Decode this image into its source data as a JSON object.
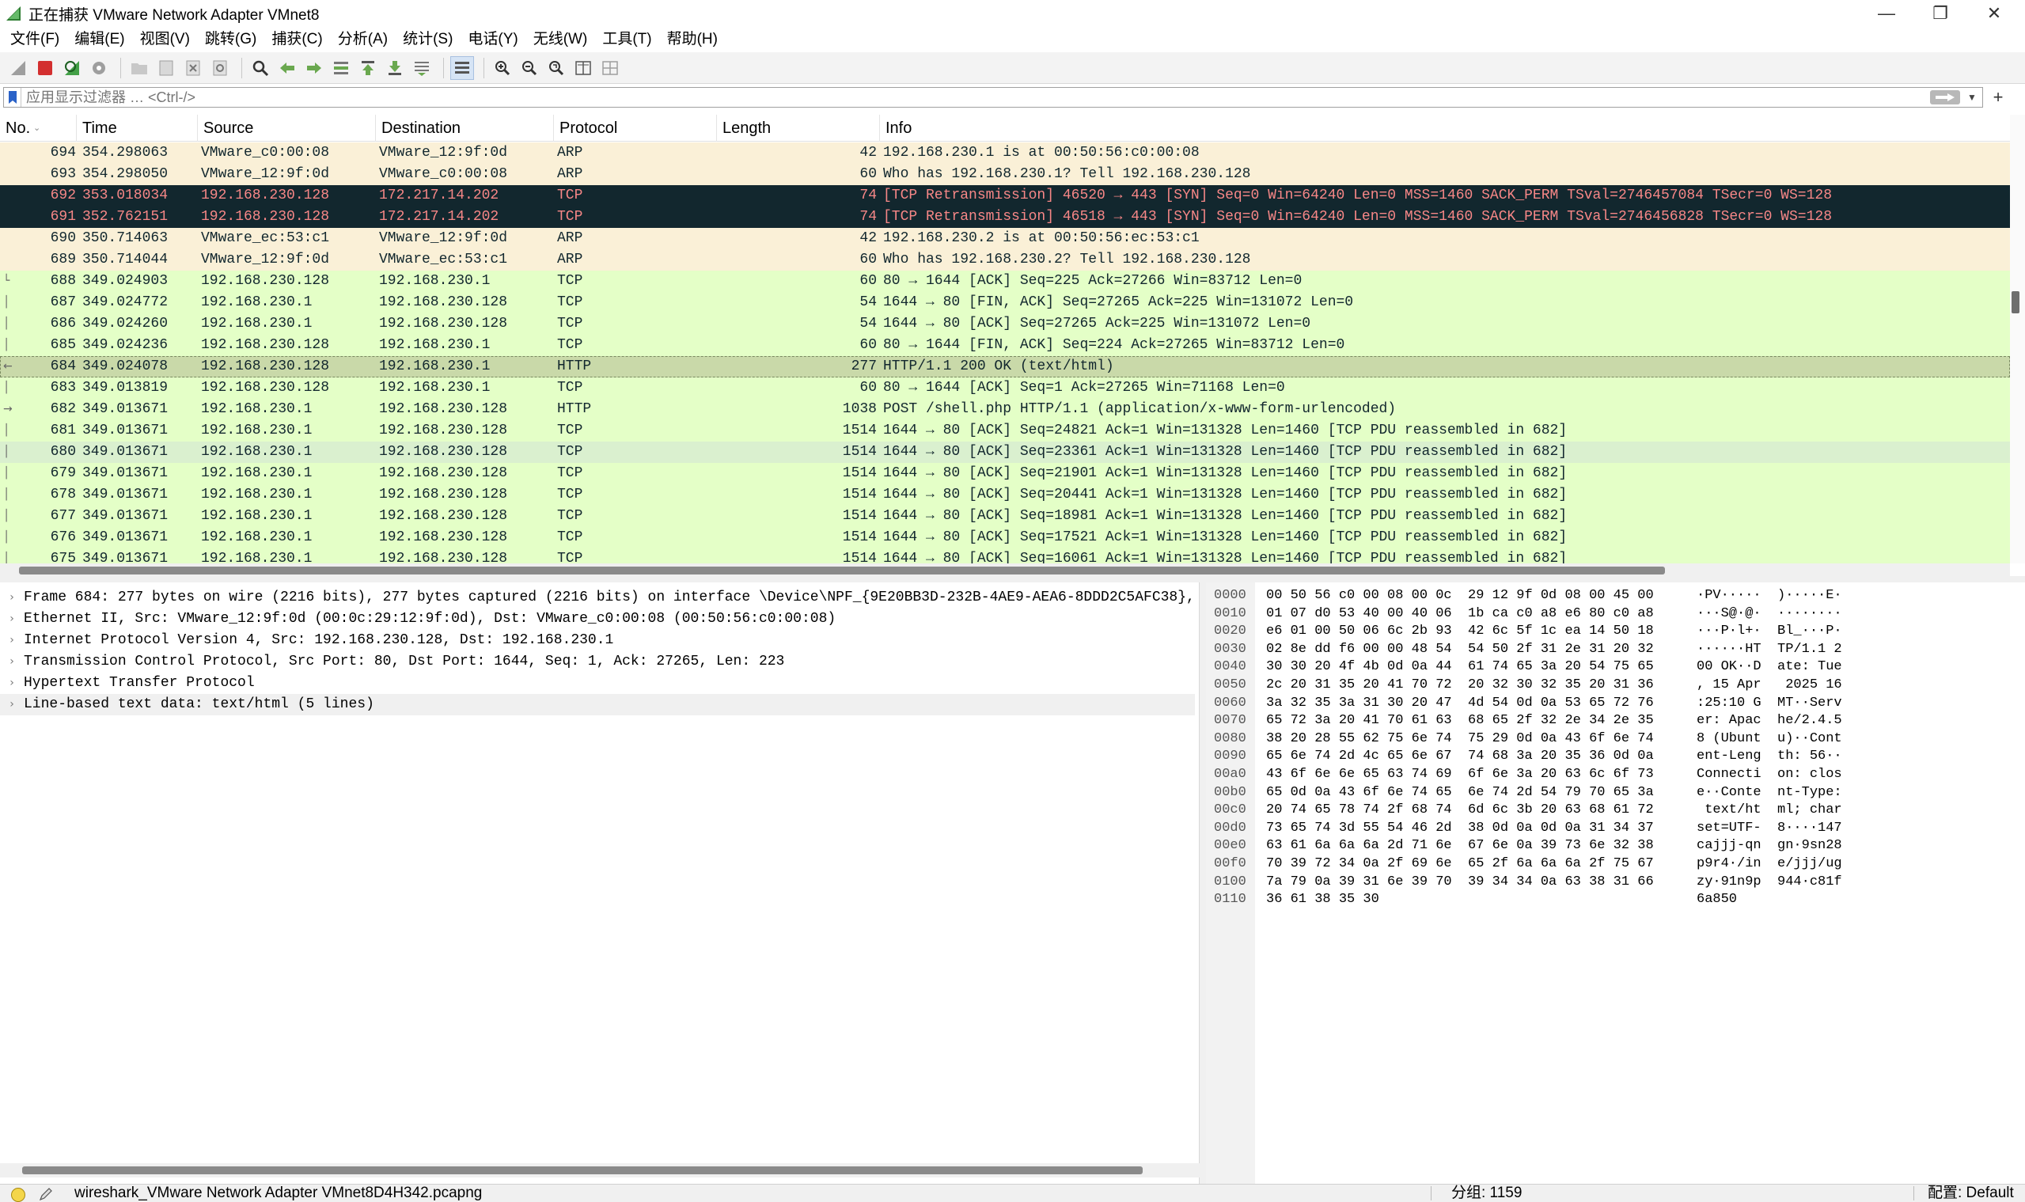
{
  "window": {
    "title": "正在捕获 VMware Network Adapter VMnet8",
    "minimize": "—",
    "maximize": "❐",
    "close": "✕"
  },
  "menu": [
    "文件(F)",
    "编辑(E)",
    "视图(V)",
    "跳转(G)",
    "捕获(C)",
    "分析(A)",
    "统计(S)",
    "电话(Y)",
    "无线(W)",
    "工具(T)",
    "帮助(H)"
  ],
  "filter": {
    "placeholder": "应用显示过滤器 … <Ctrl-/>",
    "plus": "+"
  },
  "packet_list": {
    "columns": [
      "No.",
      "Time",
      "Source",
      "Destination",
      "Protocol",
      "Length",
      "Info"
    ],
    "row_colors": {
      "arp": "#faf0d7",
      "tcp_bad": "#12272e",
      "tcp_bad_text": "#f78787",
      "tcp": "#e7e6ff",
      "http": "#e4ffc7",
      "http_selected": "#c9d9a9",
      "tcp_highlight": "#daf0cf",
      "text": "#12272e"
    },
    "rows": [
      {
        "no": "694",
        "time": "354.298063",
        "src": "VMware_c0:00:08",
        "dst": "VMware_12:9f:0d",
        "proto": "ARP",
        "len": "42",
        "info": "192.168.230.1 is at 00:50:56:c0:00:08",
        "color": "arp",
        "rel": ""
      },
      {
        "no": "693",
        "time": "354.298050",
        "src": "VMware_12:9f:0d",
        "dst": "VMware_c0:00:08",
        "proto": "ARP",
        "len": "60",
        "info": "Who has 192.168.230.1? Tell 192.168.230.128",
        "color": "arp",
        "rel": ""
      },
      {
        "no": "692",
        "time": "353.018034",
        "src": "192.168.230.128",
        "dst": "172.217.14.202",
        "proto": "TCP",
        "len": "74",
        "info": "[TCP Retransmission] 46520 → 443 [SYN] Seq=0 Win=64240 Len=0 MSS=1460 SACK_PERM TSval=2746457084 TSecr=0 WS=128",
        "color": "tcp_bad",
        "rel": ""
      },
      {
        "no": "691",
        "time": "352.762151",
        "src": "192.168.230.128",
        "dst": "172.217.14.202",
        "proto": "TCP",
        "len": "74",
        "info": "[TCP Retransmission] 46518 → 443 [SYN] Seq=0 Win=64240 Len=0 MSS=1460 SACK_PERM TSval=2746456828 TSecr=0 WS=128",
        "color": "tcp_bad",
        "rel": ""
      },
      {
        "no": "690",
        "time": "350.714063",
        "src": "VMware_ec:53:c1",
        "dst": "VMware_12:9f:0d",
        "proto": "ARP",
        "len": "42",
        "info": "192.168.230.2 is at 00:50:56:ec:53:c1",
        "color": "arp",
        "rel": ""
      },
      {
        "no": "689",
        "time": "350.714044",
        "src": "VMware_12:9f:0d",
        "dst": "VMware_ec:53:c1",
        "proto": "ARP",
        "len": "60",
        "info": "Who has 192.168.230.2? Tell 192.168.230.128",
        "color": "arp",
        "rel": ""
      },
      {
        "no": "688",
        "time": "349.024903",
        "src": "192.168.230.128",
        "dst": "192.168.230.1",
        "proto": "TCP",
        "len": "60",
        "info": "80 → 1644 [ACK] Seq=225 Ack=27266 Win=83712 Len=0",
        "color": "http",
        "rel": "└"
      },
      {
        "no": "687",
        "time": "349.024772",
        "src": "192.168.230.1",
        "dst": "192.168.230.128",
        "proto": "TCP",
        "len": "54",
        "info": "1644 → 80 [FIN, ACK] Seq=27265 Ack=225 Win=131072 Len=0",
        "color": "http",
        "rel": "│"
      },
      {
        "no": "686",
        "time": "349.024260",
        "src": "192.168.230.1",
        "dst": "192.168.230.128",
        "proto": "TCP",
        "len": "54",
        "info": "1644 → 80 [ACK] Seq=27265 Ack=225 Win=131072 Len=0",
        "color": "http",
        "rel": "│"
      },
      {
        "no": "685",
        "time": "349.024236",
        "src": "192.168.230.128",
        "dst": "192.168.230.1",
        "proto": "TCP",
        "len": "60",
        "info": "80 → 1644 [FIN, ACK] Seq=224 Ack=27265 Win=83712 Len=0",
        "color": "http",
        "rel": "│"
      },
      {
        "no": "684",
        "time": "349.024078",
        "src": "192.168.230.128",
        "dst": "192.168.230.1",
        "proto": "HTTP",
        "len": "277",
        "info": "HTTP/1.1 200 OK  (text/html)",
        "color": "http_selected",
        "rel": "←"
      },
      {
        "no": "683",
        "time": "349.013819",
        "src": "192.168.230.128",
        "dst": "192.168.230.1",
        "proto": "TCP",
        "len": "60",
        "info": "80 → 1644 [ACK] Seq=1 Ack=27265 Win=71168 Len=0",
        "color": "http",
        "rel": "│"
      },
      {
        "no": "682",
        "time": "349.013671",
        "src": "192.168.230.1",
        "dst": "192.168.230.128",
        "proto": "HTTP",
        "len": "1038",
        "info": "POST /shell.php HTTP/1.1  (application/x-www-form-urlencoded)",
        "color": "http",
        "rel": "→"
      },
      {
        "no": "681",
        "time": "349.013671",
        "src": "192.168.230.1",
        "dst": "192.168.230.128",
        "proto": "TCP",
        "len": "1514",
        "info": "1644 → 80 [ACK] Seq=24821 Ack=1 Win=131328 Len=1460 [TCP PDU reassembled in 682]",
        "color": "http",
        "rel": "│"
      },
      {
        "no": "680",
        "time": "349.013671",
        "src": "192.168.230.1",
        "dst": "192.168.230.128",
        "proto": "TCP",
        "len": "1514",
        "info": "1644 → 80 [ACK] Seq=23361 Ack=1 Win=131328 Len=1460 [TCP PDU reassembled in 682]",
        "color": "tcp_highlight",
        "rel": "│"
      },
      {
        "no": "679",
        "time": "349.013671",
        "src": "192.168.230.1",
        "dst": "192.168.230.128",
        "proto": "TCP",
        "len": "1514",
        "info": "1644 → 80 [ACK] Seq=21901 Ack=1 Win=131328 Len=1460 [TCP PDU reassembled in 682]",
        "color": "http",
        "rel": "│"
      },
      {
        "no": "678",
        "time": "349.013671",
        "src": "192.168.230.1",
        "dst": "192.168.230.128",
        "proto": "TCP",
        "len": "1514",
        "info": "1644 → 80 [ACK] Seq=20441 Ack=1 Win=131328 Len=1460 [TCP PDU reassembled in 682]",
        "color": "http",
        "rel": "│"
      },
      {
        "no": "677",
        "time": "349.013671",
        "src": "192.168.230.1",
        "dst": "192.168.230.128",
        "proto": "TCP",
        "len": "1514",
        "info": "1644 → 80 [ACK] Seq=18981 Ack=1 Win=131328 Len=1460 [TCP PDU reassembled in 682]",
        "color": "http",
        "rel": "│"
      },
      {
        "no": "676",
        "time": "349.013671",
        "src": "192.168.230.1",
        "dst": "192.168.230.128",
        "proto": "TCP",
        "len": "1514",
        "info": "1644 → 80 [ACK] Seq=17521 Ack=1 Win=131328 Len=1460 [TCP PDU reassembled in 682]",
        "color": "http",
        "rel": "│"
      },
      {
        "no": "675",
        "time": "349.013671",
        "src": "192.168.230.1",
        "dst": "192.168.230.128",
        "proto": "TCP",
        "len": "1514",
        "info": "1644 → 80 [ACK] Seq=16061 Ack=1 Win=131328 Len=1460 [TCP PDU reassembled in 682]",
        "color": "http",
        "rel": "│"
      }
    ]
  },
  "details": [
    "Frame 684: 277 bytes on wire (2216 bits), 277 bytes captured (2216 bits) on interface \\Device\\NPF_{9E20BB3D-232B-4AE9-AEA6-8DDD2C5AFC38},",
    "Ethernet II, Src: VMware_12:9f:0d (00:0c:29:12:9f:0d), Dst: VMware_c0:00:08 (00:50:56:c0:00:08)",
    "Internet Protocol Version 4, Src: 192.168.230.128, Dst: 192.168.230.1",
    "Transmission Control Protocol, Src Port: 80, Dst Port: 1644, Seq: 1, Ack: 27265, Len: 223",
    "Hypertext Transfer Protocol",
    "Line-based text data: text/html (5 lines)"
  ],
  "bytes": [
    {
      "off": "0000",
      "hex": "00 50 56 c0 00 08 00 0c  29 12 9f 0d 08 00 45 00",
      "ascii": "·PV·····  )·····E·"
    },
    {
      "off": "0010",
      "hex": "01 07 d0 53 40 00 40 06  1b ca c0 a8 e6 80 c0 a8",
      "ascii": "···S@·@·  ········"
    },
    {
      "off": "0020",
      "hex": "e6 01 00 50 06 6c 2b 93  42 6c 5f 1c ea 14 50 18",
      "ascii": "···P·l+·  Bl_···P·"
    },
    {
      "off": "0030",
      "hex": "02 8e dd f6 00 00 48 54  54 50 2f 31 2e 31 20 32",
      "ascii": "······HT  TP/1.1 2"
    },
    {
      "off": "0040",
      "hex": "30 30 20 4f 4b 0d 0a 44  61 74 65 3a 20 54 75 65",
      "ascii": "00 OK··D  ate: Tue"
    },
    {
      "off": "0050",
      "hex": "2c 20 31 35 20 41 70 72  20 32 30 32 35 20 31 36",
      "ascii": ", 15 Apr   2025 16"
    },
    {
      "off": "0060",
      "hex": "3a 32 35 3a 31 30 20 47  4d 54 0d 0a 53 65 72 76",
      "ascii": ":25:10 G  MT··Serv"
    },
    {
      "off": "0070",
      "hex": "65 72 3a 20 41 70 61 63  68 65 2f 32 2e 34 2e 35",
      "ascii": "er: Apac  he/2.4.5"
    },
    {
      "off": "0080",
      "hex": "38 20 28 55 62 75 6e 74  75 29 0d 0a 43 6f 6e 74",
      "ascii": "8 (Ubunt  u)··Cont"
    },
    {
      "off": "0090",
      "hex": "65 6e 74 2d 4c 65 6e 67  74 68 3a 20 35 36 0d 0a",
      "ascii": "ent-Leng  th: 56··"
    },
    {
      "off": "00a0",
      "hex": "43 6f 6e 6e 65 63 74 69  6f 6e 3a 20 63 6c 6f 73",
      "ascii": "Connecti  on: clos"
    },
    {
      "off": "00b0",
      "hex": "65 0d 0a 43 6f 6e 74 65  6e 74 2d 54 79 70 65 3a",
      "ascii": "e··Conte  nt-Type:"
    },
    {
      "off": "00c0",
      "hex": "20 74 65 78 74 2f 68 74  6d 6c 3b 20 63 68 61 72",
      "ascii": " text/ht  ml; char"
    },
    {
      "off": "00d0",
      "hex": "73 65 74 3d 55 54 46 2d  38 0d 0a 0d 0a 31 34 37",
      "ascii": "set=UTF-  8····147"
    },
    {
      "off": "00e0",
      "hex": "63 61 6a 6a 6a 2d 71 6e  67 6e 0a 39 73 6e 32 38",
      "ascii": "cajjj-qn  gn·9sn28"
    },
    {
      "off": "00f0",
      "hex": "70 39 72 34 0a 2f 69 6e  65 2f 6a 6a 6a 2f 75 67",
      "ascii": "p9r4·/in  e/jjj/ug"
    },
    {
      "off": "0100",
      "hex": "7a 79 0a 39 31 6e 39 70  39 34 34 0a 63 38 31 66",
      "ascii": "zy·91n9p  944·c81f"
    },
    {
      "off": "0110",
      "hex": "36 61 38 35 30",
      "ascii": "6a850"
    }
  ],
  "status": {
    "file": "wireshark_VMware Network Adapter VMnet8D4H342.pcapng",
    "packets": "分组: 1159",
    "profile": "配置: Default"
  }
}
